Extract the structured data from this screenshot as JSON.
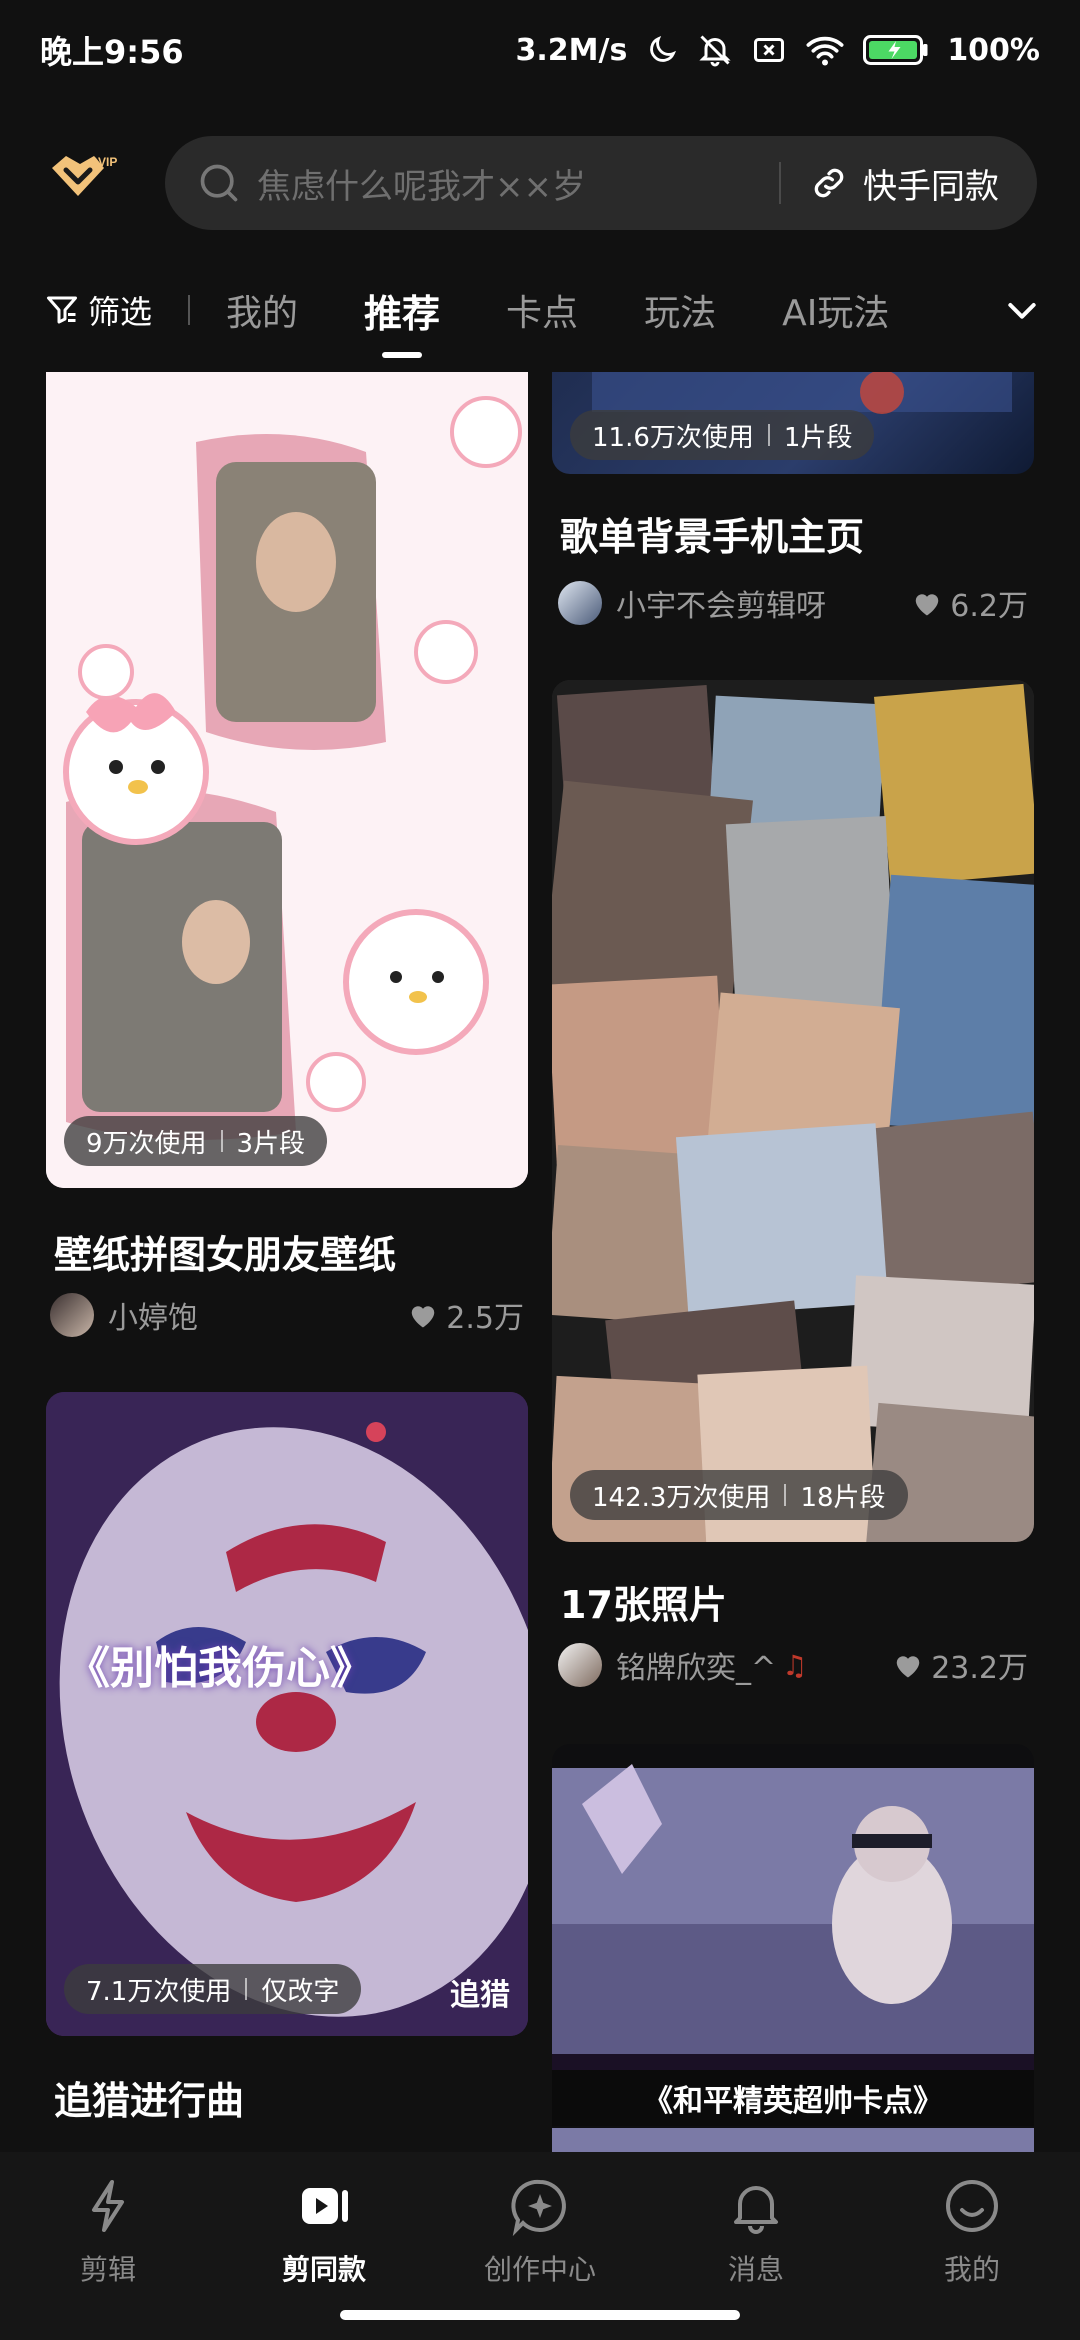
{
  "status_bar": {
    "time": "晚上9:56",
    "network_speed": "3.2M/s",
    "battery": "100%"
  },
  "header": {
    "logo_badge": "VIP",
    "search_placeholder": "焦虑什么呢我才××岁",
    "search_action": "快手同款"
  },
  "tabs": {
    "filter_label": "筛选",
    "items": [
      "我的",
      "推荐",
      "卡点",
      "玩法",
      "AI玩法"
    ],
    "active": "推荐"
  },
  "cards": [
    {
      "usage": "11.6万次使用",
      "segments": "1片段",
      "title": "歌单背景手机主页",
      "author": "小宇不会剪辑呀",
      "likes": "6.2万"
    },
    {
      "usage": "9万次使用",
      "segments": "3片段",
      "title": "壁纸拼图女朋友壁纸",
      "author": "小婷饱",
      "likes": "2.5万"
    },
    {
      "usage": "142.3万次使用",
      "segments": "18片段",
      "title": "17张照片",
      "author": "铭牌欣奕_^",
      "likes": "23.2万"
    },
    {
      "usage": "7.1万次使用",
      "segments": "仅改字",
      "title": "追猎进行曲",
      "corner_tag": "追猎",
      "overlay_text": "《别怕我伤心》"
    },
    {
      "overlay_text": "《和平精英超帅卡点》"
    }
  ],
  "bottom_nav": {
    "items": [
      "剪辑",
      "剪同款",
      "创作中心",
      "消息",
      "我的"
    ],
    "active": "剪同款"
  },
  "colors": {
    "background": "#111111",
    "search_bg": "#2a2a2a",
    "vip_gold": "#f2c27a",
    "muted_text": "#9b9b9b"
  }
}
